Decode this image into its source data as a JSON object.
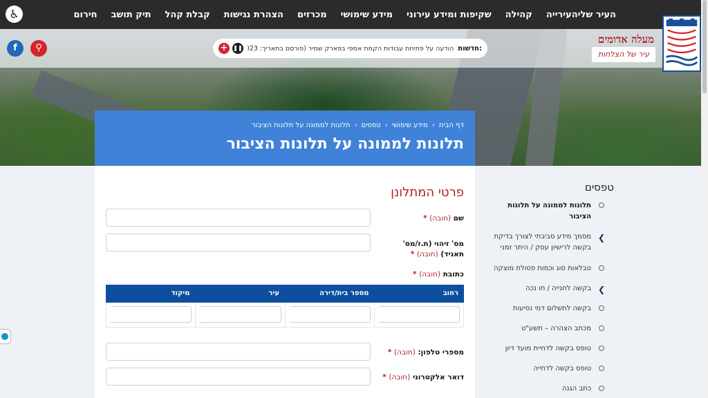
{
  "nav": {
    "items": [
      "העיר שלי",
      "העירייה",
      "קהילה",
      "שקיפות ומידע עירוני",
      "מידע שימושי",
      "מכרזים",
      "הצהרת נגישות",
      "קבלת קהל",
      "תיק תושב",
      "חירום"
    ]
  },
  "brand": {
    "city_name": "מעלה אדומים",
    "slogan": "עיר של הצלחות"
  },
  "ticker": {
    "label": "חדשות:",
    "text": "הודעה על פתיחת עבודות הקמת אמפי בפארק שמיר (פורסם בתאריך: 2023...)"
  },
  "breadcrumbs": [
    "דף הבית",
    "מידע שימושי",
    "טפסים",
    "תלונות לממונה על תלונות הציבור"
  ],
  "page_title": "תלונות לממונה על תלונות הציבור",
  "form": {
    "heading": "פרטי המתלונן",
    "required_word": "(חובה)",
    "fields": {
      "name": "שם",
      "id": "מס' זיהוי (ת.ז/מס' תאגיד)",
      "address": "כתובת",
      "phone": "מספרי טלפון:",
      "email": "דואר אלקטרוני"
    },
    "address_columns": [
      "רחוב",
      "מספר בית/דירה",
      "עיר",
      "מיקוד"
    ]
  },
  "sidebar": {
    "title": "טפסים",
    "items": [
      "תלונות לממונה על תלונות הציבור",
      "מסמך מידע סביבתי לצורך בדיקת בקשה לרישיון עסק / היתר זמני",
      "טבלאות סוג וכמות פסולת מוצקה",
      "בקשה לחנייה / חו נכה",
      "בקשה לתשלום דמי נסיעות",
      "מכתב הצהרה – תשע\"ט",
      "טופס בקשה לדחיית מועד דיון",
      "טופס בקשה לדחייה",
      "כתב הגנה"
    ]
  },
  "colors": {
    "nav_bg": "#2b2b2b",
    "banner_blue": "#3f82d8",
    "table_head": "#0d4f9e",
    "accent_red": "#b51f25"
  }
}
